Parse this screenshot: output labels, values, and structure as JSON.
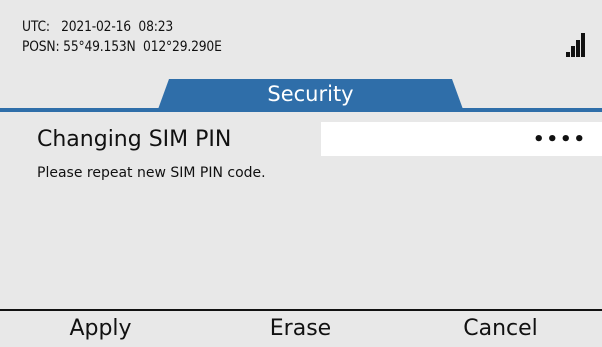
{
  "status": {
    "utc_line": "UTC:   2021-02-16  08:23",
    "posn_line": "POSN: 55°49.153N  012°29.290E",
    "signal_icon": "signal-strength-icon",
    "signal_level": "4 of 4 bars"
  },
  "tab": {
    "label": "Security",
    "color": "#2f6ea9"
  },
  "main": {
    "heading": "Changing SIM PIN",
    "pin_value": "••••",
    "message": "Please repeat new SIM PIN code."
  },
  "softkeys": {
    "apply": "Apply",
    "erase": "Erase",
    "cancel": "Cancel"
  },
  "colors": {
    "background": "#e8e8e8",
    "accent": "#2f6ea9",
    "field": "#ffffff",
    "text": "#111111"
  }
}
